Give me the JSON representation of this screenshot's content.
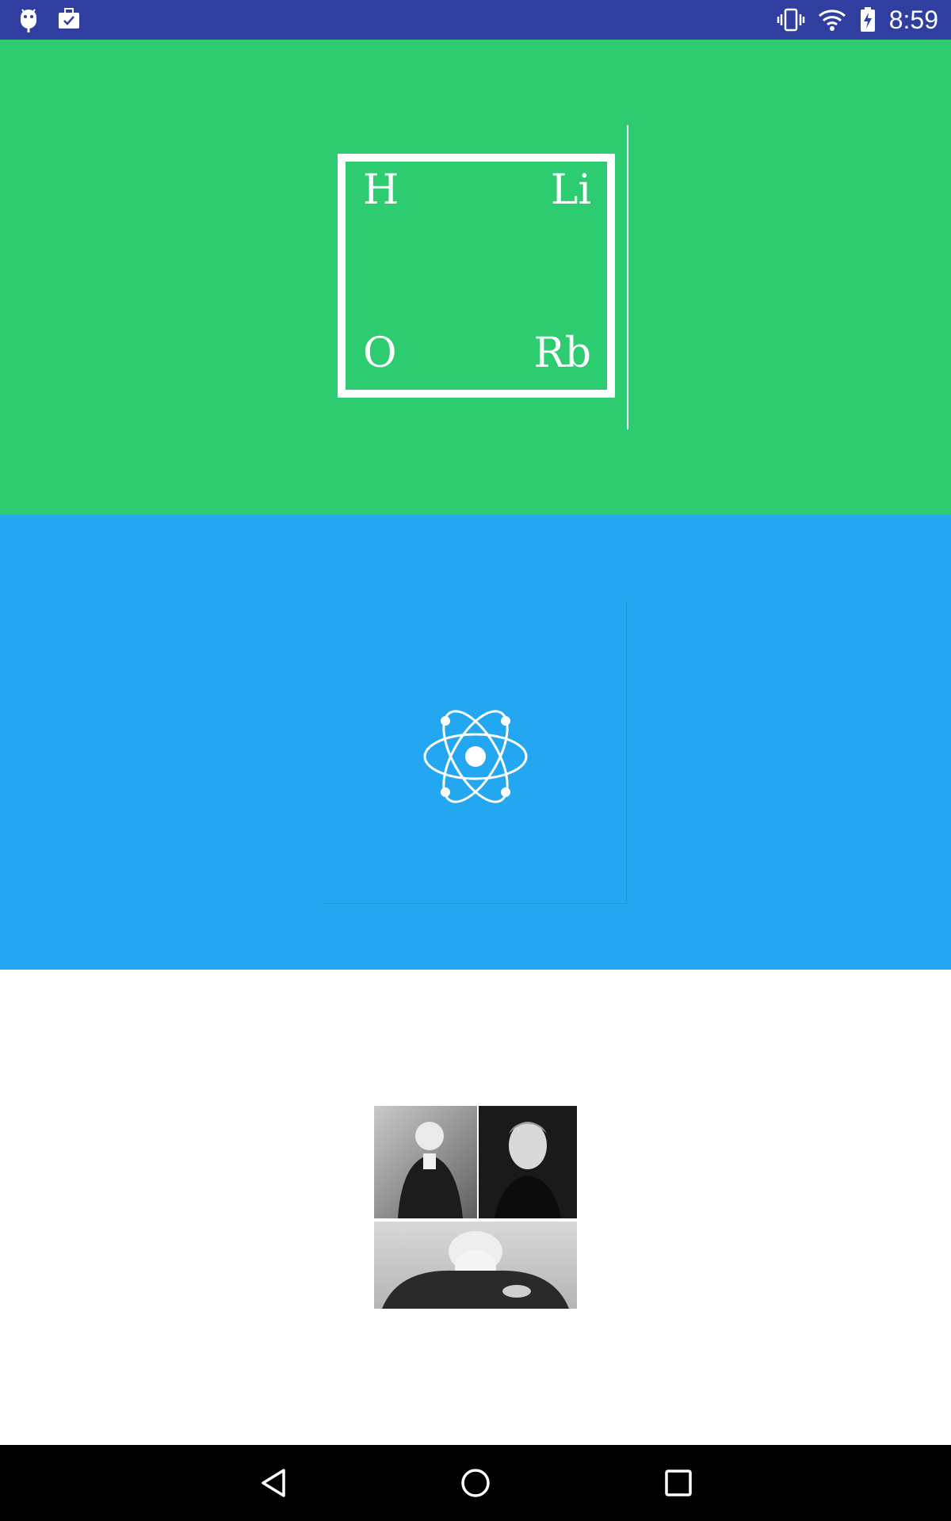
{
  "status_bar": {
    "time": "8:59",
    "left_icons": [
      "android-debug-icon",
      "briefcase-check-icon"
    ],
    "right_icons": [
      "vibrate-icon",
      "wifi-icon",
      "battery-charging-icon"
    ],
    "background": "#303f9f"
  },
  "sections": [
    {
      "id": "periodic",
      "background": "#2ecc71"
    },
    {
      "id": "atom",
      "background": "#22a7f0"
    },
    {
      "id": "scientists",
      "background": "#ffffff"
    }
  ],
  "periodic_tile": {
    "top_left": "H",
    "top_right": "Li",
    "bottom_left": "O",
    "bottom_right": "Rb"
  },
  "nav_bar": {
    "buttons": [
      "back-icon",
      "home-icon",
      "recents-icon"
    ],
    "background": "#000000"
  }
}
